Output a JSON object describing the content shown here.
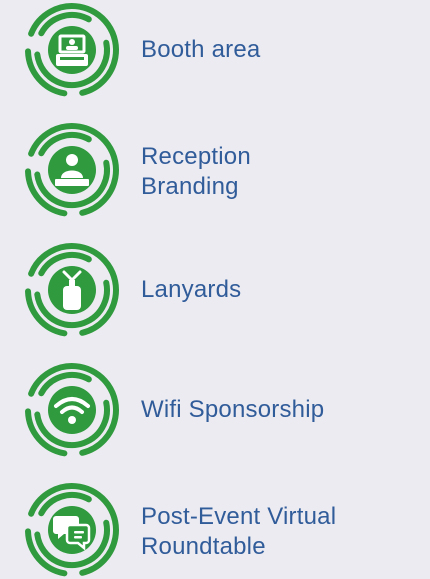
{
  "colors": {
    "background": "#ecebf1",
    "accent_green": "#2f9a3e",
    "text_blue": "#315c9a"
  },
  "items": [
    {
      "icon": "booth-icon",
      "label": "Booth area"
    },
    {
      "icon": "reception-icon",
      "label": "Reception\nBranding"
    },
    {
      "icon": "lanyard-icon",
      "label": "Lanyards"
    },
    {
      "icon": "wifi-icon",
      "label": "Wifi Sponsorship"
    },
    {
      "icon": "chat-icon",
      "label": "Post-Event Virtual\nRoundtable"
    }
  ]
}
